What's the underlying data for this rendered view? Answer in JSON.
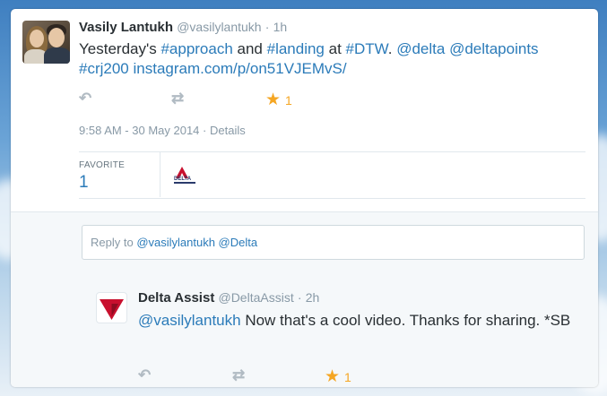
{
  "tweet": {
    "author_name": "Vasily Lantukh",
    "author_handle": "@vasilylantukh",
    "sep": "·",
    "time_ago": "1h",
    "text_parts": [
      {
        "t": "Yesterday's ",
        "link": false
      },
      {
        "t": "#approach",
        "link": true
      },
      {
        "t": " and ",
        "link": false
      },
      {
        "t": "#landing",
        "link": true
      },
      {
        "t": " at ",
        "link": false
      },
      {
        "t": "#DTW",
        "link": true
      },
      {
        "t": ". ",
        "link": false
      },
      {
        "t": "@delta",
        "link": true
      },
      {
        "t": " ",
        "link": false
      },
      {
        "t": "@deltapoints",
        "link": true
      },
      {
        "t": " ",
        "link": false
      },
      {
        "t": "#crj200",
        "link": true
      },
      {
        "t": " ",
        "link": false
      },
      {
        "t": "instagram.com/p/on51VJEMvS/",
        "link": true
      }
    ],
    "favorite_count": "1",
    "timestamp": "9:58 AM - 30 May 2014",
    "details_sep": "·",
    "details_label": "Details",
    "stats_label": "FAVORITE",
    "stats_count": "1",
    "favoriter_logo_text": "DELTA"
  },
  "reply_box": {
    "prefix": "Reply to ",
    "mentions": "@vasilylantukh @Delta"
  },
  "reply": {
    "author_name": "Delta Assist",
    "author_handle": "@DeltaAssist",
    "sep": "·",
    "time_ago": "2h",
    "mention": "@vasilylantukh",
    "text": " Now that's a cool video. Thanks for sharing. *SB",
    "favorite_count": "1"
  },
  "colors": {
    "link": "#2b7bb9",
    "star": "#f5a623",
    "delta_red": "#c8102e"
  },
  "icons": {
    "reply": "reply-arrow-icon",
    "retweet": "retweet-icon",
    "favorite": "star-icon"
  }
}
